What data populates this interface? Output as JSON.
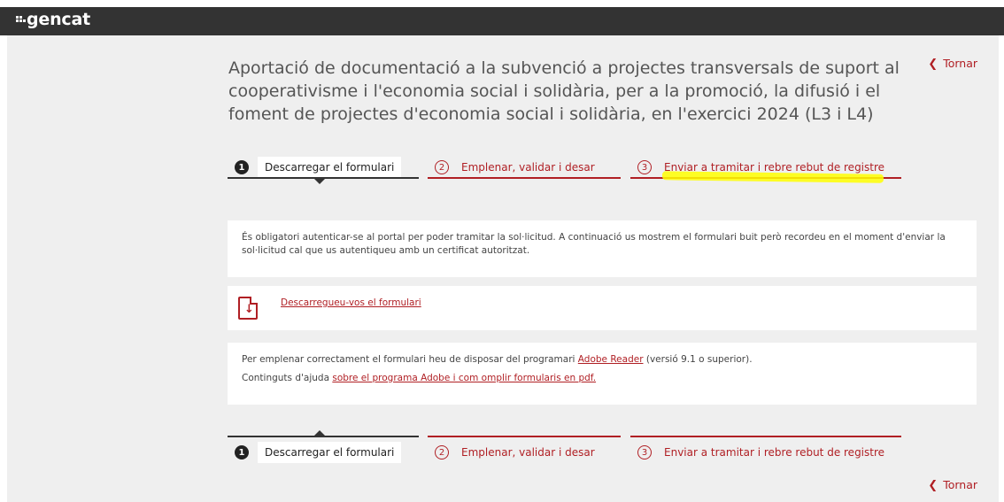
{
  "header": {
    "logo_text": "gencat"
  },
  "page": {
    "title": "Aportació de documentació a la subvenció a projectes transversals de suport al cooperativisme i l'economia social i solidària, per a la promoció, la difusió i el foment de projectes d'economia social i solidària, en l'exercici 2024 (L3 i L4)",
    "back_label": "Tornar"
  },
  "steps": [
    {
      "number": "1",
      "label": "Descarregar el formulari",
      "state": "active"
    },
    {
      "number": "2",
      "label": "Emplenar, validar i desar",
      "state": "inactive"
    },
    {
      "number": "3",
      "label": "Enviar a tramitar i rebre rebut de registre",
      "state": "inactive"
    }
  ],
  "notice": {
    "text": "És obligatori autenticar-se al portal per poder tramitar la sol·licitud. A continuació us mostrem el formulari buit però recordeu en el moment d'enviar la sol·licitud cal que us autentiqueu amb un certificat autoritzat."
  },
  "download": {
    "link_label": "Descarregueu-vos el formulari",
    "icon": "pdf-download-icon"
  },
  "help": {
    "line1_prefix": "Per emplenar correctament el formulari heu de disposar del programari ",
    "line1_link": "Adobe Reader",
    "line1_suffix": " (versió 9.1 o superior).",
    "line2_prefix": "Continguts d'ajuda ",
    "line2_link": "sobre el programa Adobe i com omplir formularis en pdf."
  },
  "colors": {
    "accent": "#b01f24",
    "topbar": "#333333",
    "background": "#efefef",
    "highlight": "#ffff00"
  }
}
